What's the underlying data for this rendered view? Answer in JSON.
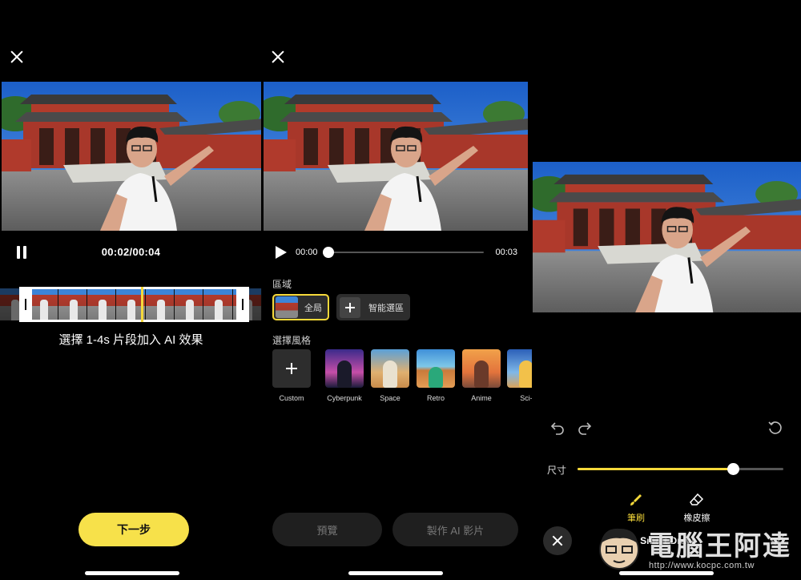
{
  "panel1": {
    "time": "00:02/00:04",
    "hint": "選擇 1-4s 片段加入 AI 效果",
    "next_label": "下一步"
  },
  "panel2": {
    "time_current": "00:00",
    "time_end": "00:03",
    "seek_progress": 0.0,
    "region_label": "區域",
    "region_all": "全局",
    "region_smart": "智能選區",
    "style_label": "選擇風格",
    "styles": [
      "Custom",
      "Cyberpunk",
      "Space",
      "Retro",
      "Anime",
      "Sci-"
    ],
    "preview_label": "預覽",
    "make_label": "製作 AI 影片"
  },
  "panel3": {
    "size_label": "尺寸",
    "size_value": 0.76,
    "brush_label": "筆刷",
    "eraser_label": "橡皮擦",
    "title": "Smart Draw"
  },
  "watermark": {
    "text": "電腦王阿達",
    "url": "http://www.kocpc.com.tw"
  },
  "colors": {
    "accent": "#f7e14a",
    "background": "#000000",
    "button_dark": "#1f1f1f"
  }
}
